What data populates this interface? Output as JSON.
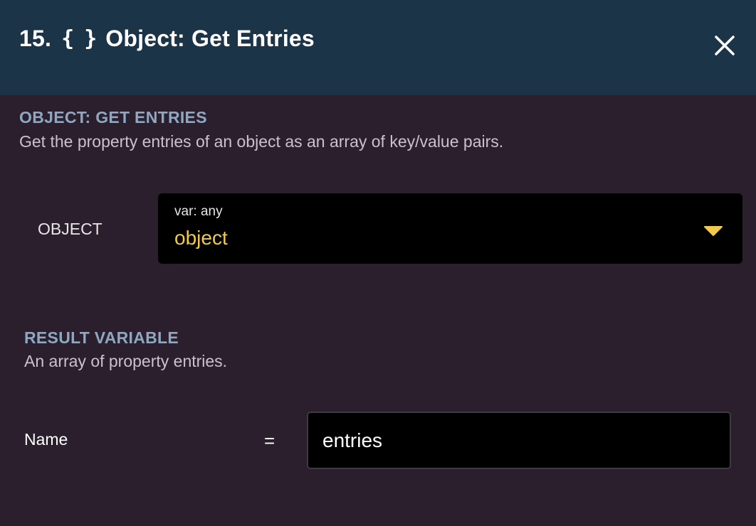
{
  "header": {
    "step_number": "15.",
    "icon": "braces-icon",
    "icon_glyph": "{ }",
    "title": "Object: Get Entries",
    "close_icon": "close-icon"
  },
  "operation": {
    "heading": "OBJECT: GET ENTRIES",
    "description": "Get the property entries of an object as an array of key/value pairs."
  },
  "object_field": {
    "label": "OBJECT",
    "type_hint": "var: any",
    "selected_value": "object",
    "dropdown_icon": "caret-down-icon"
  },
  "result": {
    "heading": "RESULT VARIABLE",
    "description": "An array of property entries.",
    "name_label": "Name",
    "equals": "=",
    "name_value": "entries"
  },
  "colors": {
    "header_bg": "#1c3448",
    "body_bg": "#2b1f2e",
    "section_heading": "#8ea8c2",
    "value_accent": "#f2c94c"
  }
}
